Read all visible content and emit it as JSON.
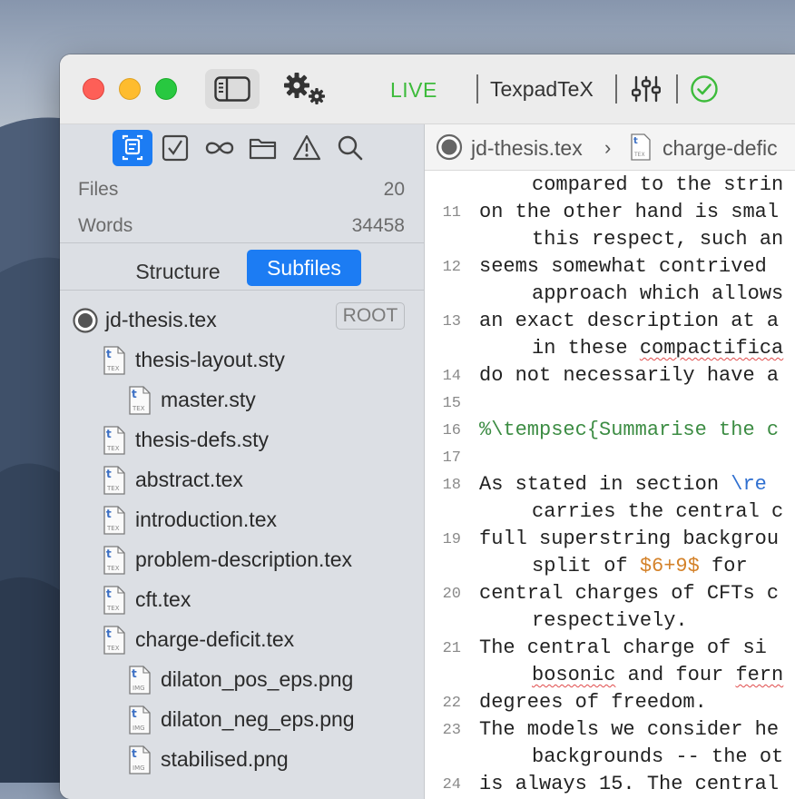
{
  "toolbar": {
    "live_label": "LIVE",
    "engine_label": "TexpadTeX",
    "icons": [
      "sidebar-toggle-icon",
      "gears-icon",
      "mixer-icon",
      "checkmark-circle-icon"
    ],
    "live_color": "#3dbb3b",
    "ok_color": "#3dbb3b"
  },
  "sidebar": {
    "tabs": [
      "outline-icon",
      "todo-checkbox-icon",
      "references-infinity-icon",
      "folder-icon",
      "warning-icon",
      "search-icon"
    ],
    "active_tab": "outline-icon",
    "stats": {
      "files_label": "Files",
      "files_value": "20",
      "words_label": "Words",
      "words_value": "34458"
    },
    "segment": {
      "structure": "Structure",
      "subfiles": "Subfiles",
      "selected": "Subfiles"
    },
    "tree": [
      {
        "name": "jd-thesis.tex",
        "badge": "ROOT",
        "type": "root",
        "depth": 0
      },
      {
        "name": "thesis-layout.sty",
        "type": "tex",
        "depth": 1
      },
      {
        "name": "master.sty",
        "type": "tex",
        "depth": 2
      },
      {
        "name": "thesis-defs.sty",
        "type": "tex",
        "depth": 1
      },
      {
        "name": "abstract.tex",
        "type": "tex",
        "depth": 1
      },
      {
        "name": "introduction.tex",
        "type": "tex",
        "depth": 1
      },
      {
        "name": "problem-description.tex",
        "type": "tex",
        "depth": 1
      },
      {
        "name": "cft.tex",
        "type": "tex",
        "depth": 1
      },
      {
        "name": "charge-deficit.tex",
        "type": "tex",
        "depth": 1
      },
      {
        "name": "dilaton_pos_eps.png",
        "type": "img",
        "depth": 2
      },
      {
        "name": "dilaton_neg_eps.png",
        "type": "img",
        "depth": 2
      },
      {
        "name": "stabilised.png",
        "type": "img",
        "depth": 2
      }
    ],
    "accent": "#1c7cf3"
  },
  "editor": {
    "breadcrumb": {
      "root_file": "jd-thesis.tex",
      "separator": "›",
      "current_file": "charge-defic"
    },
    "lines": [
      {
        "n": "",
        "indent": true,
        "parts": [
          {
            "t": "compared to the strin"
          }
        ]
      },
      {
        "n": "11",
        "indent": false,
        "parts": [
          {
            "t": "on the other hand is smal"
          }
        ]
      },
      {
        "n": "",
        "indent": true,
        "parts": [
          {
            "t": "this respect, such an"
          }
        ]
      },
      {
        "n": "12",
        "indent": false,
        "parts": [
          {
            "t": "seems somewhat contrived"
          }
        ]
      },
      {
        "n": "",
        "indent": true,
        "parts": [
          {
            "t": "approach which allows"
          }
        ]
      },
      {
        "n": "13",
        "indent": false,
        "parts": [
          {
            "t": "an exact description at a"
          }
        ]
      },
      {
        "n": "",
        "indent": true,
        "parts": [
          {
            "t": "in these "
          },
          {
            "t": "compactifica",
            "c": "spell"
          }
        ]
      },
      {
        "n": "14",
        "indent": false,
        "parts": [
          {
            "t": "do not necessarily have a"
          }
        ]
      },
      {
        "n": "15",
        "indent": false,
        "parts": []
      },
      {
        "n": "16",
        "indent": false,
        "parts": [
          {
            "t": "%\\tempsec{Summarise the c",
            "c": "cm"
          }
        ]
      },
      {
        "n": "17",
        "indent": false,
        "parts": []
      },
      {
        "n": "18",
        "indent": false,
        "parts": [
          {
            "t": "As stated in section "
          },
          {
            "t": "\\re",
            "c": "kw"
          }
        ]
      },
      {
        "n": "",
        "indent": true,
        "parts": [
          {
            "t": "carries the central c"
          }
        ]
      },
      {
        "n": "19",
        "indent": false,
        "parts": [
          {
            "t": "full superstring backgrou"
          }
        ]
      },
      {
        "n": "",
        "indent": true,
        "parts": [
          {
            "t": "split of "
          },
          {
            "t": "$6+9$",
            "c": "math"
          },
          {
            "t": " for"
          }
        ]
      },
      {
        "n": "20",
        "indent": false,
        "parts": [
          {
            "t": "central charges of CFTs c"
          }
        ]
      },
      {
        "n": "",
        "indent": true,
        "parts": [
          {
            "t": "respectively."
          }
        ]
      },
      {
        "n": "21",
        "indent": false,
        "parts": [
          {
            "t": "The central charge of si"
          }
        ]
      },
      {
        "n": "",
        "indent": true,
        "parts": [
          {
            "t": "bosonic",
            "c": "spell"
          },
          {
            "t": " and four "
          },
          {
            "t": "fern",
            "c": "spell"
          }
        ]
      },
      {
        "n": "22",
        "indent": false,
        "parts": [
          {
            "t": "degrees of freedom."
          }
        ]
      },
      {
        "n": "23",
        "indent": false,
        "parts": [
          {
            "t": "The models we consider he"
          }
        ]
      },
      {
        "n": "",
        "indent": true,
        "parts": [
          {
            "t": "backgrounds -- the ot"
          }
        ]
      },
      {
        "n": "24",
        "indent": false,
        "parts": [
          {
            "t": "is always 15. The central"
          }
        ]
      }
    ]
  }
}
